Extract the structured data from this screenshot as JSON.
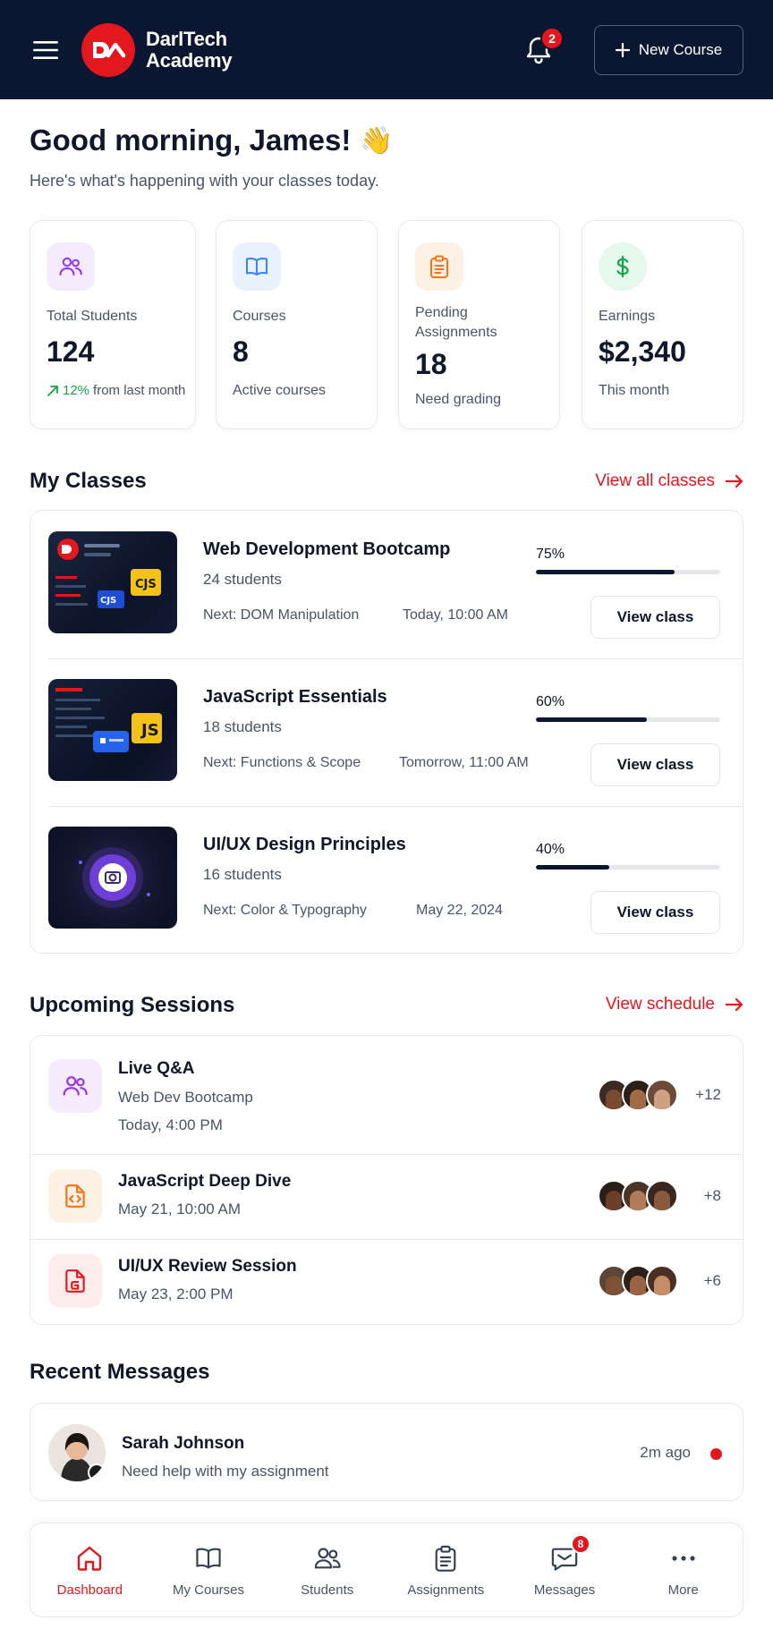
{
  "header": {
    "brand_line1": "DarlTech",
    "brand_line2": "Academy",
    "notification_count": "2",
    "new_course_label": "New Course"
  },
  "greeting": {
    "title": "Good morning, James!",
    "emoji": "👋",
    "subtitle": "Here's what's happening with your classes today."
  },
  "stats": [
    {
      "label": "Total Students",
      "value": "124",
      "trend_value": "12%",
      "trend_text": "from last month",
      "icon": "users-icon",
      "color": "#9333ea"
    },
    {
      "label": "Courses",
      "value": "8",
      "foot": "Active courses",
      "icon": "book-icon",
      "color": "#3b82f6"
    },
    {
      "label": "Pending Assignments",
      "value": "18",
      "foot": "Need grading",
      "icon": "clipboard-icon",
      "color": "#f97316"
    },
    {
      "label": "Earnings",
      "value": "$2,340",
      "foot": "This month",
      "icon": "dollar-icon",
      "color": "#16a34a"
    }
  ],
  "my_classes": {
    "title": "My Classes",
    "link": "View all classes",
    "items": [
      {
        "title": "Web Development Bootcamp",
        "students": "24 students",
        "next": "Next: DOM Manipulation",
        "time": "Today, 10:00 AM",
        "progress_label": "75%",
        "progress": 0.75,
        "button": "View class"
      },
      {
        "title": "JavaScript Essentials",
        "students": "18 students",
        "next": "Next: Functions & Scope",
        "time": "Tomorrow, 11:00 AM",
        "progress_label": "60%",
        "progress": 0.6,
        "button": "View class"
      },
      {
        "title": "UI/UX Design Principles",
        "students": "16 students",
        "next": "Next: Color & Typography",
        "time": "May 22, 2024",
        "progress_label": "40%",
        "progress": 0.4,
        "button": "View class"
      }
    ]
  },
  "sessions": {
    "title": "Upcoming Sessions",
    "link": "View schedule",
    "items": [
      {
        "title": "Live Q&A",
        "course": "Web Dev Bootcamp",
        "time": "Today, 4:00 PM",
        "extra": "+12",
        "icon": "users-icon",
        "color": "#9333ea"
      },
      {
        "title": "JavaScript Deep Dive",
        "time": "May 21, 10:00 AM",
        "extra": "+8",
        "icon": "code-file-icon",
        "color": "#f97316"
      },
      {
        "title": "UI/UX Review Session",
        "time": "May 23, 2:00 PM",
        "extra": "+6",
        "icon": "design-file-icon",
        "color": "#e3171e"
      }
    ]
  },
  "messages": {
    "title": "Recent Messages",
    "items": [
      {
        "name": "Sarah Johnson",
        "text": "Need help with my assignment",
        "time": "2m ago"
      }
    ]
  },
  "nav": {
    "items": [
      {
        "label": "Dashboard",
        "icon": "home-icon"
      },
      {
        "label": "My Courses",
        "icon": "book-icon"
      },
      {
        "label": "Students",
        "icon": "users-icon"
      },
      {
        "label": "Assignments",
        "icon": "clipboard-icon"
      },
      {
        "label": "Messages",
        "icon": "message-icon",
        "badge": "8"
      },
      {
        "label": "More",
        "icon": "more-icon"
      }
    ]
  },
  "colors": {
    "header_bg": "#0b1730",
    "accent": "#e3171e",
    "trend_green": "#16a34a"
  }
}
